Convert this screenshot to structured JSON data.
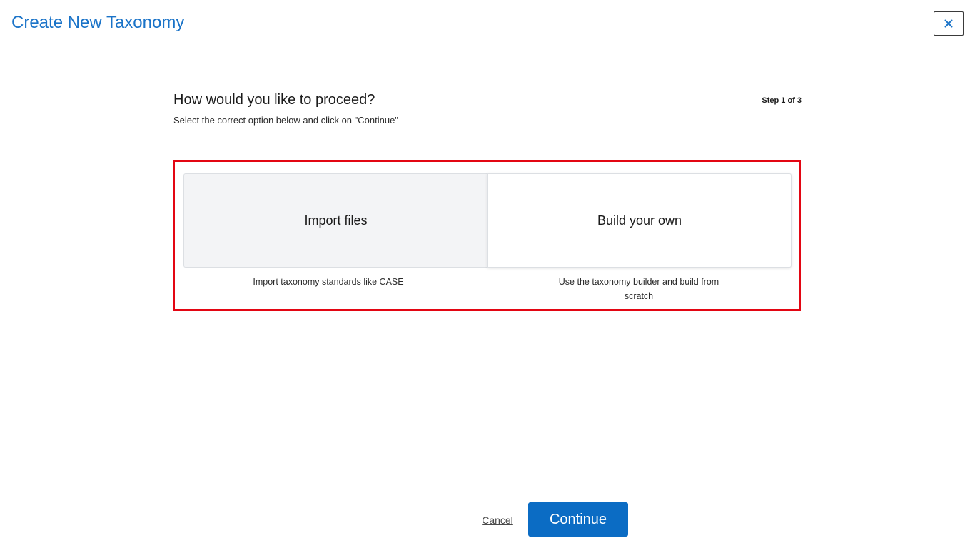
{
  "header": {
    "title": "Create New Taxonomy",
    "close_icon": "close-icon"
  },
  "step": {
    "heading": "How would you like to proceed?",
    "subheading": "Select the correct option below and click on \"Continue\"",
    "indicator": "Step 1 of 3"
  },
  "options": [
    {
      "label": "Import files",
      "description": "Import taxonomy standards like CASE"
    },
    {
      "label": "Build your own",
      "description": "Use the taxonomy builder and build from scratch"
    }
  ],
  "footer": {
    "cancel_label": "Cancel",
    "continue_label": "Continue"
  },
  "colors": {
    "title": "#1a73c8",
    "highlight_frame": "#e30613",
    "primary_button": "#0b6cc4"
  }
}
